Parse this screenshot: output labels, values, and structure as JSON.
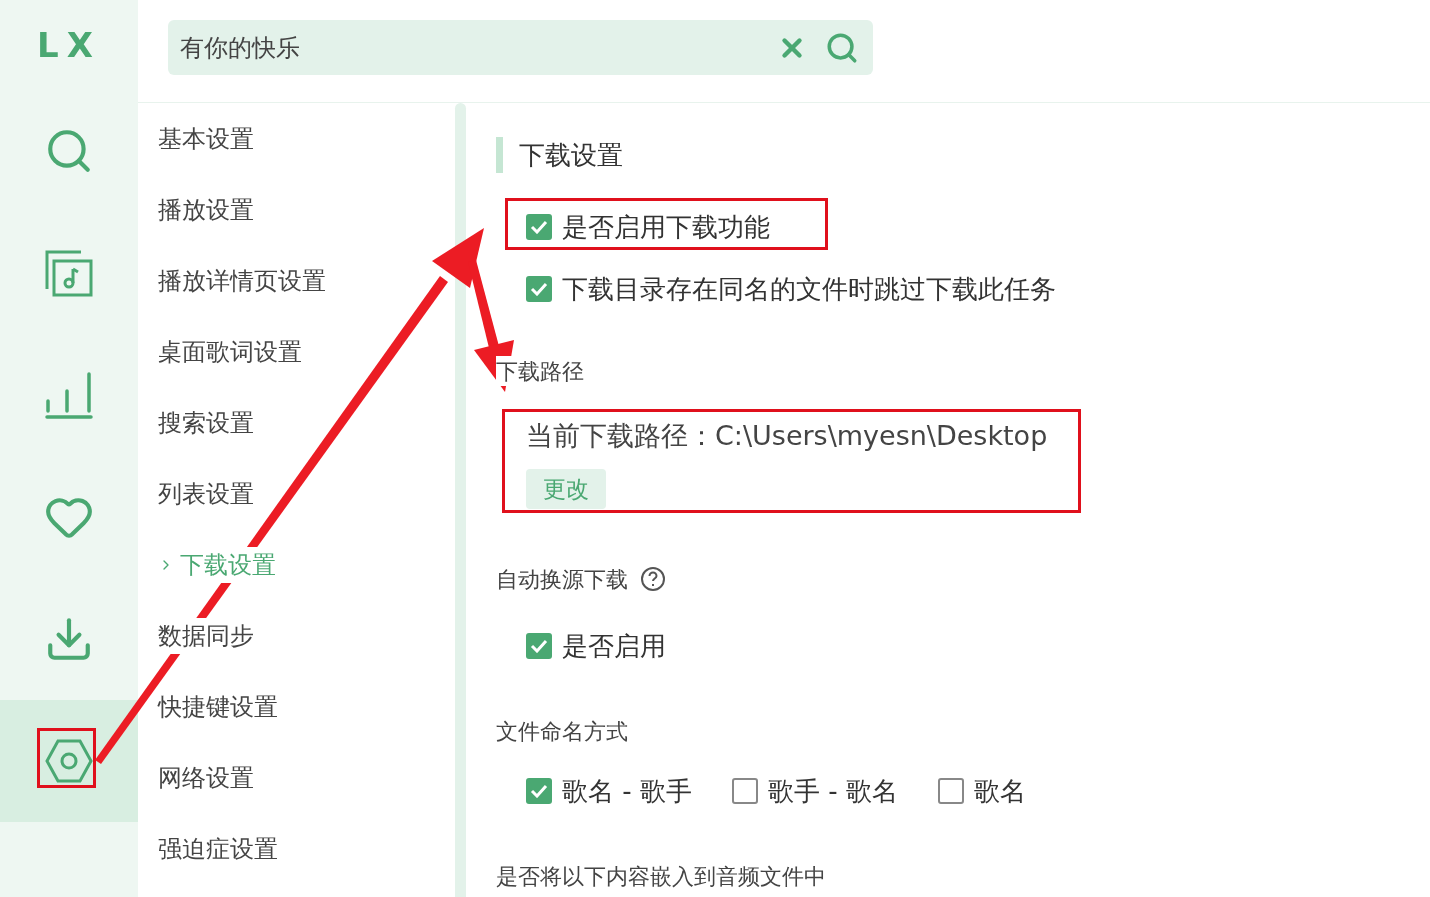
{
  "logo": "LX",
  "nav": [
    {
      "kind": "search",
      "selected": false
    },
    {
      "kind": "music-list",
      "selected": false
    },
    {
      "kind": "chart",
      "selected": false
    },
    {
      "kind": "heart",
      "selected": false
    },
    {
      "kind": "download",
      "selected": false
    },
    {
      "kind": "settings",
      "selected": true
    }
  ],
  "search": {
    "value": "有你的快乐"
  },
  "menu": [
    {
      "label": "基本设置",
      "selected": false
    },
    {
      "label": "播放设置",
      "selected": false
    },
    {
      "label": "播放详情页设置",
      "selected": false
    },
    {
      "label": "桌面歌词设置",
      "selected": false
    },
    {
      "label": "搜索设置",
      "selected": false
    },
    {
      "label": "列表设置",
      "selected": false
    },
    {
      "label": "下载设置",
      "selected": true
    },
    {
      "label": "数据同步",
      "selected": false
    },
    {
      "label": "快捷键设置",
      "selected": false
    },
    {
      "label": "网络设置",
      "selected": false
    },
    {
      "label": "强迫症设置",
      "selected": false
    }
  ],
  "section_title": "下载设置",
  "download_options": [
    {
      "label": "是否启用下载功能",
      "checked": true
    },
    {
      "label": "下载目录存在同名的文件时跳过下载此任务",
      "checked": true
    }
  ],
  "path": {
    "title": "下载路径",
    "current": "当前下载路径：C:\\Users\\myesn\\Desktop",
    "button": "更改"
  },
  "auto_switch": {
    "title": "自动换源下载",
    "option": {
      "label": "是否启用",
      "checked": true
    }
  },
  "naming": {
    "title": "文件命名方式",
    "options": [
      {
        "label": "歌名 - 歌手",
        "checked": true
      },
      {
        "label": "歌手 - 歌名",
        "checked": false
      },
      {
        "label": "歌名",
        "checked": false
      }
    ]
  },
  "embed_title": "是否将以下内容嵌入到音频文件中"
}
